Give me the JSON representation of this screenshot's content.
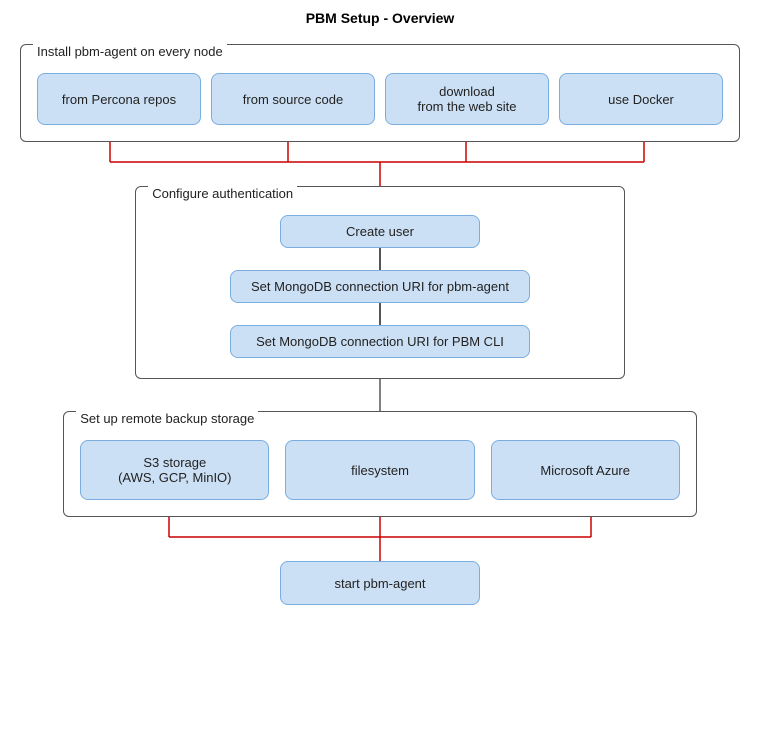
{
  "title": "PBM Setup - Overview",
  "install_section": {
    "label": "Install pbm-agent on every node",
    "boxes": [
      {
        "id": "percona-repos",
        "text": "from Percona repos"
      },
      {
        "id": "source-code",
        "text": "from source code"
      },
      {
        "id": "download-web",
        "text": "download\nfrom the web site"
      },
      {
        "id": "use-docker",
        "text": "use Docker"
      }
    ]
  },
  "auth_section": {
    "label": "Configure authentication",
    "boxes": [
      {
        "id": "create-user",
        "text": "Create user"
      },
      {
        "id": "mongo-uri-agent",
        "text": "Set MongoDB connection URI for pbm-agent"
      },
      {
        "id": "mongo-uri-cli",
        "text": "Set MongoDB connection URI for PBM CLI"
      }
    ]
  },
  "backup_section": {
    "label": "Set up remote backup storage",
    "boxes": [
      {
        "id": "s3-storage",
        "text": "S3 storage\n(AWS, GCP, MinIO)"
      },
      {
        "id": "filesystem",
        "text": "filesystem"
      },
      {
        "id": "microsoft-azure",
        "text": "Microsoft Azure"
      }
    ]
  },
  "start_box": {
    "text": "start pbm-agent"
  }
}
